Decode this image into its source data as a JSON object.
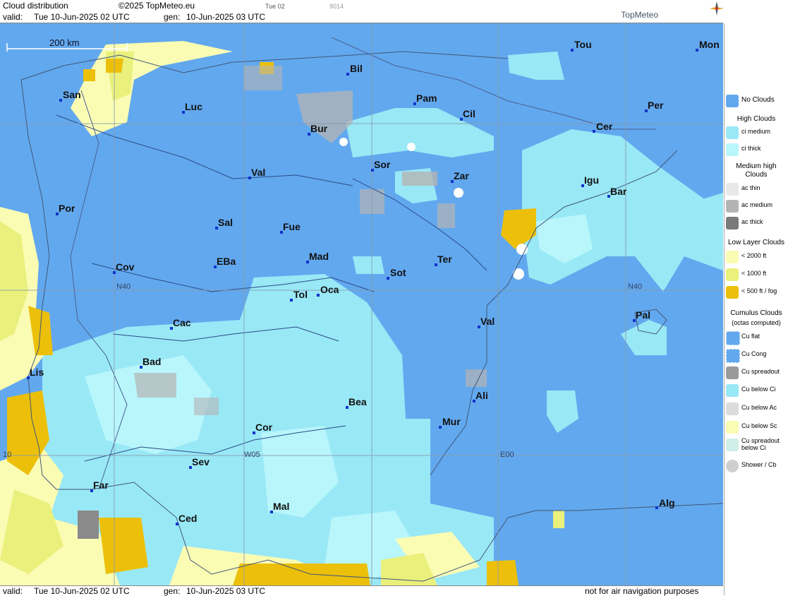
{
  "header": {
    "title": "Cloud distribution",
    "copyright": "©2025 TopMeteo.eu",
    "run_tag": "Tue 02",
    "code": "9014",
    "valid_label": "valid:",
    "valid_value": "Tue  10-Jun-2025  02 UTC",
    "gen_label": "gen:",
    "gen_value": "10-Jun-2025 03 UTC",
    "brand": "TopMeteo"
  },
  "footer": {
    "valid_label": "valid:",
    "valid_value": "Tue  10-Jun-2025  02 UTC",
    "gen_label": "gen:",
    "gen_value": "10-Jun-2025 03 UTC",
    "disclaimer": "not for air navigation purposes"
  },
  "map": {
    "scale_label": "200 km",
    "grid_labels": [
      "N40",
      "N40",
      "W05",
      "E00",
      "10"
    ],
    "cities": [
      "San",
      "Luc",
      "Bil",
      "Pam",
      "Cil",
      "Tou",
      "Mon",
      "Per",
      "Cer",
      "Bur",
      "Sor",
      "Zar",
      "Igu",
      "Bar",
      "Val",
      "Por",
      "Sal",
      "Fue",
      "Mad",
      "Ter",
      "EBa",
      "Cov",
      "Sot",
      "Tol",
      "Oca",
      "Val",
      "Pal",
      "Cac",
      "Lis",
      "Bad",
      "Bea",
      "Ali",
      "Cor",
      "Mur",
      "Sev",
      "Far",
      "Mal",
      "Ced",
      "Alg"
    ],
    "colors": {
      "no_clouds": "#62a8ee",
      "ci_medium": "#99e8f6",
      "ci_thick": "#b8f6fc",
      "ac_thin": "#e8e8e8",
      "ac_medium": "#b4b4b4",
      "ac_thick": "#7a7a7a",
      "low_2000": "#fafcb4",
      "low_1000": "#eaf07c",
      "low_500": "#ecc00a"
    }
  },
  "legend": {
    "items": [
      {
        "label": "No Clouds",
        "color": "#62a8ee"
      },
      {
        "section": "High Clouds"
      },
      {
        "label": "ci medium",
        "color": "#99e8f6"
      },
      {
        "label": "ci thick",
        "color": "#b8f6fc"
      },
      {
        "section": "Medium high Clouds"
      },
      {
        "label": "ac thin",
        "color": "#e8e8e8"
      },
      {
        "label": "ac medium",
        "color": "#b4b4b4"
      },
      {
        "label": "ac thick",
        "color": "#7a7a7a"
      },
      {
        "section": "Low Layer Clouds"
      },
      {
        "label": "< 2000 ft",
        "color": "#fafcb4"
      },
      {
        "label": "< 1000 ft",
        "color": "#eaf07c"
      },
      {
        "label": "< 500 ft / fog",
        "color": "#ecc00a"
      },
      {
        "section": "Cumulus Clouds",
        "note": "(octas computed)"
      },
      {
        "label": "Cu flat",
        "color": "#62a8ee"
      },
      {
        "label": "Cu Cong",
        "color": "#62a8ee"
      },
      {
        "label": "Cu spreadout",
        "color": "#9a9a9a"
      },
      {
        "label": "Cu below Ci",
        "color": "#99e8f6"
      },
      {
        "label": "Cu below Ac",
        "color": "#dcdcdc"
      },
      {
        "label": "Cu below Sc",
        "color": "#fafcb4"
      },
      {
        "label": "Cu spreadout below Ci",
        "color": "#cfeee8"
      },
      {
        "label": "Shower / Cb",
        "color": "#cfcfcf"
      }
    ]
  }
}
